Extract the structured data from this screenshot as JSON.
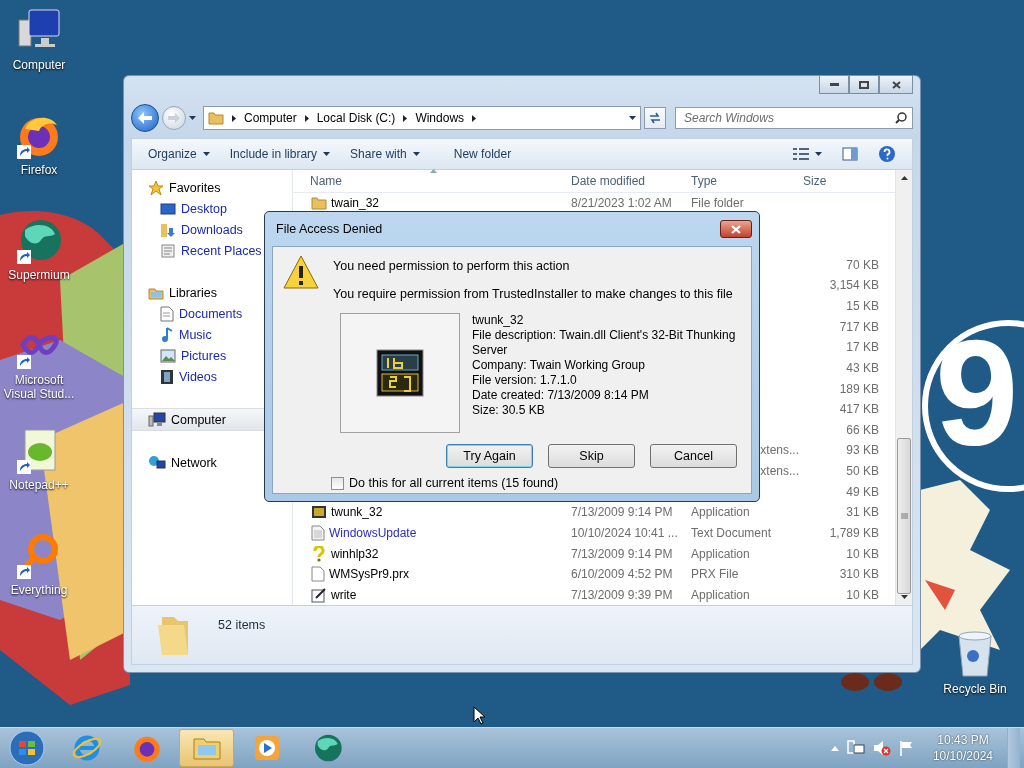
{
  "wallpaper": {
    "badge": "9"
  },
  "desktop_icons": [
    {
      "label": "Computer",
      "kind": "computer",
      "shortcut": false
    },
    {
      "label": "Firefox",
      "kind": "firefox",
      "shortcut": true
    },
    {
      "label": "Supermium",
      "kind": "supermium",
      "shortcut": true
    },
    {
      "label": "Microsoft Visual Stud...",
      "kind": "vs",
      "shortcut": true
    },
    {
      "label": "Notepad++",
      "kind": "notepad",
      "shortcut": true
    },
    {
      "label": "Everything",
      "kind": "everything",
      "shortcut": true
    }
  ],
  "recycle_bin": {
    "label": "Recycle Bin"
  },
  "explorer": {
    "address": {
      "crumbs": [
        "Computer",
        "Local Disk (C:)",
        "Windows"
      ]
    },
    "search": {
      "placeholder": "Search Windows"
    },
    "commands": [
      {
        "label": "Organize",
        "dropdown": true
      },
      {
        "label": "Include in library",
        "dropdown": true
      },
      {
        "label": "Share with",
        "dropdown": true
      },
      {
        "label": "New folder",
        "dropdown": false
      }
    ],
    "nav": [
      {
        "label": "Favorites",
        "kind": "star",
        "selected": false,
        "children": [
          {
            "label": "Desktop",
            "kind": "desktop",
            "selected": false
          },
          {
            "label": "Downloads",
            "kind": "downloads",
            "selected": false
          },
          {
            "label": "Recent Places",
            "kind": "recent",
            "selected": false
          }
        ]
      },
      {
        "label": "Libraries",
        "kind": "libraries",
        "selected": false,
        "children": [
          {
            "label": "Documents",
            "kind": "documents",
            "selected": false
          },
          {
            "label": "Music",
            "kind": "music",
            "selected": false
          },
          {
            "label": "Pictures",
            "kind": "pictures",
            "selected": false
          },
          {
            "label": "Videos",
            "kind": "videos",
            "selected": false
          }
        ]
      },
      {
        "label": "Computer",
        "kind": "computer",
        "selected": true
      },
      {
        "label": "Network",
        "kind": "network",
        "selected": false
      }
    ],
    "columns": [
      "Name",
      "Date modified",
      "Type",
      "Size"
    ],
    "rows": [
      {
        "kind": "folder",
        "name": "twain_32",
        "color": "#000000",
        "date": "8/21/2023 1:02 AM",
        "type": "File folder"
      },
      {},
      {},
      {
        "size": "70 KB"
      },
      {
        "size": "3,154 KB"
      },
      {
        "size": "15 KB"
      },
      {
        "size": "717 KB"
      },
      {
        "size": "17 KB"
      },
      {
        "size": "43 KB"
      },
      {
        "size": "189 KB"
      },
      {
        "size": "417 KB"
      },
      {
        "size": "66 KB"
      },
      {
        "type": "xtens...",
        "size": "93 KB"
      },
      {
        "type": "xtens...",
        "size": "50 KB"
      },
      {
        "size": "49 KB"
      },
      {
        "kind": "app16",
        "name": "twunk_32",
        "color": "#000000",
        "date": "7/13/2009 9:14 PM",
        "type": "Application",
        "size": "31 KB"
      },
      {
        "kind": "text",
        "name": "WindowsUpdate",
        "color": "#2b2bb8",
        "date": "10/10/2024 10:41 ...",
        "type": "Text Document",
        "size": "1,789 KB"
      },
      {
        "kind": "help",
        "name": "winhlp32",
        "color": "#000000",
        "date": "7/13/2009 9:14 PM",
        "type": "Application",
        "size": "10 KB"
      },
      {
        "kind": "file",
        "name": "WMSysPr9.prx",
        "color": "#000000",
        "date": "6/10/2009 4:52 PM",
        "type": "PRX File",
        "size": "310 KB"
      },
      {
        "kind": "write",
        "name": "write",
        "color": "#000000",
        "date": "7/13/2009 9:39 PM",
        "type": "Application",
        "size": "10 KB"
      }
    ],
    "status": "52 items"
  },
  "dialog": {
    "title": "File Access Denied",
    "heading": "You need permission to perform this action",
    "message": "You require permission from TrustedInstaller to make changes to this file",
    "file_lines": [
      "twunk_32",
      "File description: Twain.dll Client's 32-Bit Thunking Server",
      "Company: Twain Working Group",
      "File version: 1.7.1.0",
      "Date created: 7/13/2009 8:14 PM",
      "Size: 30.5 KB"
    ],
    "buttons": [
      {
        "label": "Try Again",
        "default": true
      },
      {
        "label": "Skip",
        "default": false
      },
      {
        "label": "Cancel",
        "default": false
      }
    ],
    "checkbox": {
      "label": "Do this for all current items (15 found)",
      "checked": false
    }
  },
  "taskbar": {
    "items": [
      {
        "kind": "ie",
        "selected": false
      },
      {
        "kind": "firefox",
        "selected": false
      },
      {
        "kind": "explorer",
        "selected": true
      },
      {
        "kind": "media",
        "selected": false
      },
      {
        "kind": "supermium",
        "selected": false
      }
    ],
    "time": "10:43 PM",
    "date": "10/10/2024"
  }
}
